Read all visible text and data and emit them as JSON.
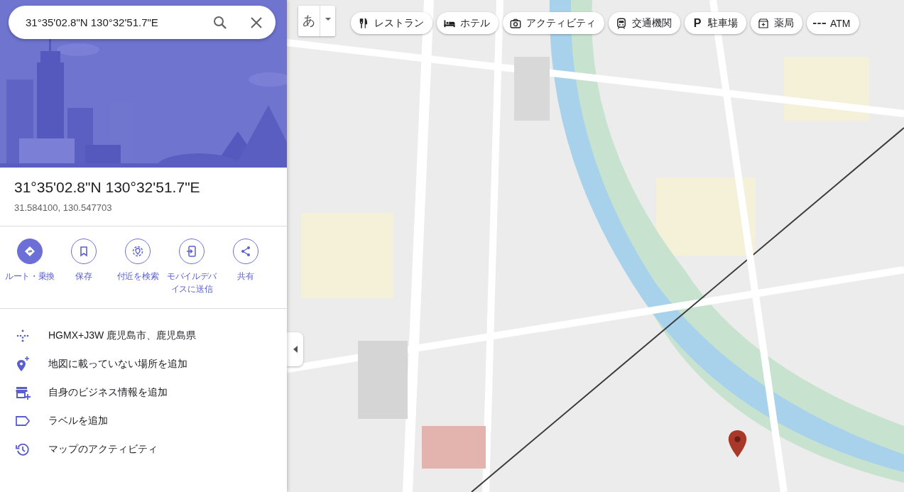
{
  "search": {
    "value": "31°35'02.8\"N 130°32'51.7\"E"
  },
  "place": {
    "title": "31°35'02.8\"N 130°32'51.7\"E",
    "coordinates": "31.584100, 130.547703"
  },
  "actions": [
    {
      "kind": "route",
      "label": "ルート・乗換",
      "primary": true
    },
    {
      "kind": "save",
      "label": "保存",
      "primary": false
    },
    {
      "kind": "nearby",
      "label": "付近を検索",
      "primary": false
    },
    {
      "kind": "send",
      "label": "モバイルデバイスに送信",
      "primary": false
    },
    {
      "kind": "share",
      "label": "共有",
      "primary": false
    }
  ],
  "details": [
    {
      "kind": "pluscode",
      "text": "HGMX+J3W 鹿児島市、鹿児島県"
    },
    {
      "kind": "addplace",
      "text": "地図に載っていない場所を追加"
    },
    {
      "kind": "business",
      "text": "自身のビジネス情報を追加"
    },
    {
      "kind": "label",
      "text": "ラベルを追加"
    },
    {
      "kind": "activity",
      "text": "マップのアクティビティ"
    }
  ],
  "map": {
    "kind": "picture",
    "input_tool": "あ",
    "chips": [
      {
        "kind": "restaurant",
        "label": "レストラン"
      },
      {
        "kind": "hotel",
        "label": "ホテル"
      },
      {
        "kind": "camera",
        "label": "アクティビティ"
      },
      {
        "kind": "transit",
        "label": "交通機関"
      },
      {
        "kind": "parking",
        "icon_text": "P",
        "label": "駐車場"
      },
      {
        "kind": "pharmacy",
        "label": "薬局"
      },
      {
        "kind": "atm",
        "label": "ATM"
      }
    ]
  }
}
